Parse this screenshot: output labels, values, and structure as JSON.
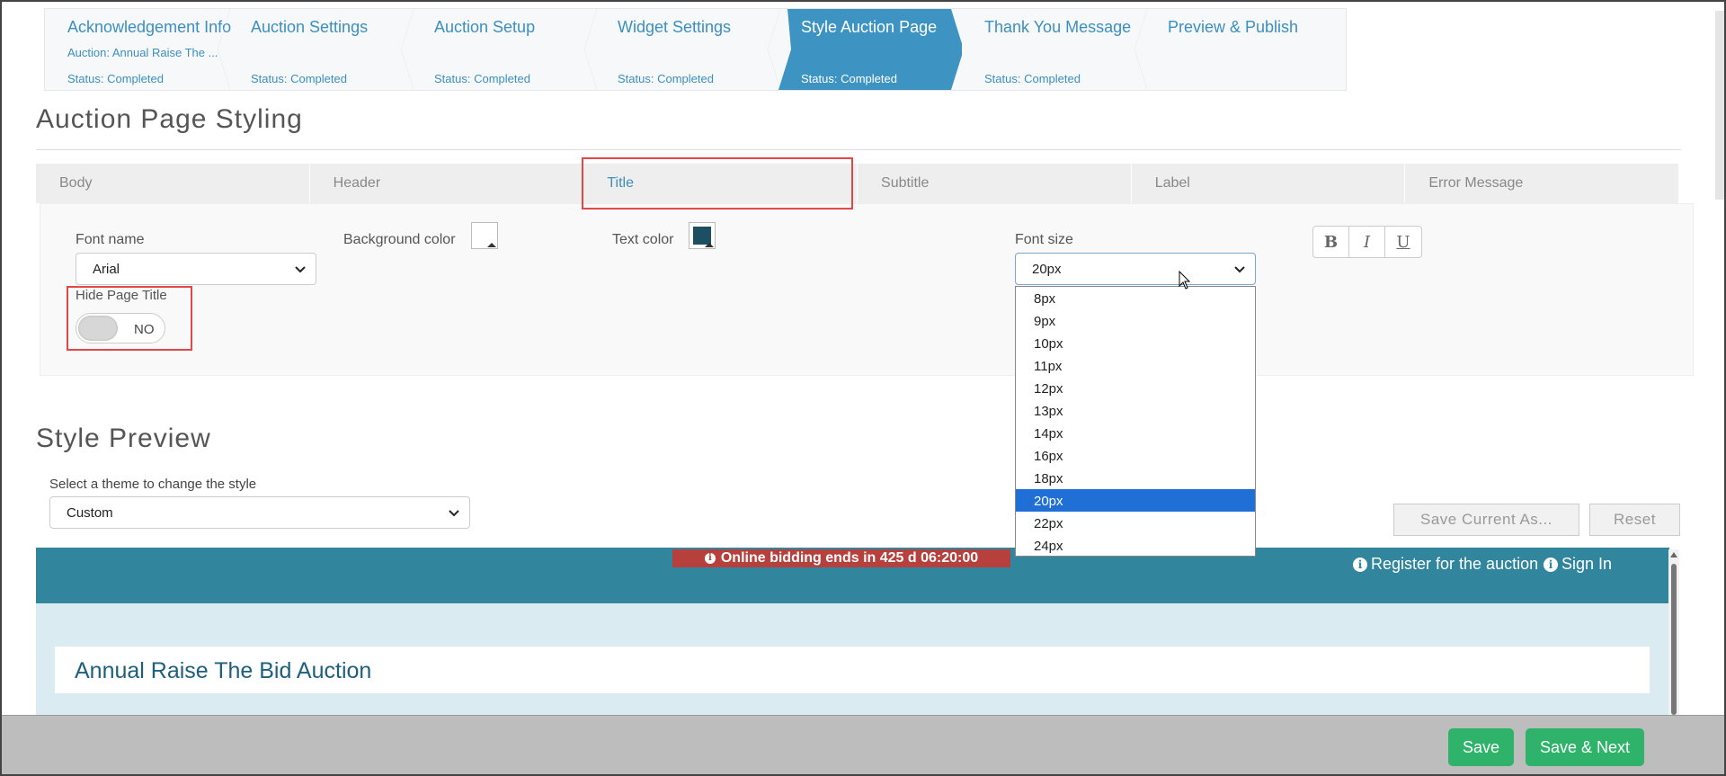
{
  "wizard": {
    "steps": [
      {
        "name": "Acknowledgement Info",
        "sub": "Auction: Annual Raise The ...",
        "status": "Status: Completed"
      },
      {
        "name": "Auction Settings",
        "status": "Status: Completed"
      },
      {
        "name": "Auction Setup",
        "status": "Status: Completed"
      },
      {
        "name": "Widget Settings",
        "status": "Status: Completed"
      },
      {
        "name": "Style Auction Page",
        "status": "Status: Completed"
      },
      {
        "name": "Thank You Message",
        "status": "Status: Completed"
      },
      {
        "name": "Preview & Publish"
      }
    ],
    "active_index": 4
  },
  "styling": {
    "title": "Auction Page Styling",
    "tabs": [
      "Body",
      "Header",
      "Title",
      "Subtitle",
      "Label",
      "Error Message"
    ],
    "active_tab": "Title",
    "font_name_label": "Font name",
    "font_name_value": "Arial",
    "background_color_label": "Background color",
    "background_color": "#ffffff",
    "text_color_label": "Text color",
    "text_color": "#1d4f63",
    "font_size_label": "Font size",
    "font_size_value": "20px",
    "font_size_options": [
      "8px",
      "9px",
      "10px",
      "11px",
      "12px",
      "13px",
      "14px",
      "16px",
      "18px",
      "20px",
      "22px",
      "24px"
    ],
    "format_buttons": [
      "B",
      "I",
      "U"
    ],
    "hide_title_label": "Hide Page Title",
    "hide_title_toggle": "NO"
  },
  "preview": {
    "title": "Style Preview",
    "theme_label": "Select a theme to change the style",
    "theme_value": "Custom",
    "save_as_label": "Save Current As...",
    "reset_label": "Reset",
    "countdown": "Online bidding ends in 425 d 06:20:00",
    "register_link": "Register for the auction",
    "signin_link": "Sign In",
    "auction_title": "Annual Raise The Bid Auction",
    "bar_color": "#31859c"
  },
  "footer": {
    "save_label": "Save",
    "save_next_label": "Save & Next"
  }
}
